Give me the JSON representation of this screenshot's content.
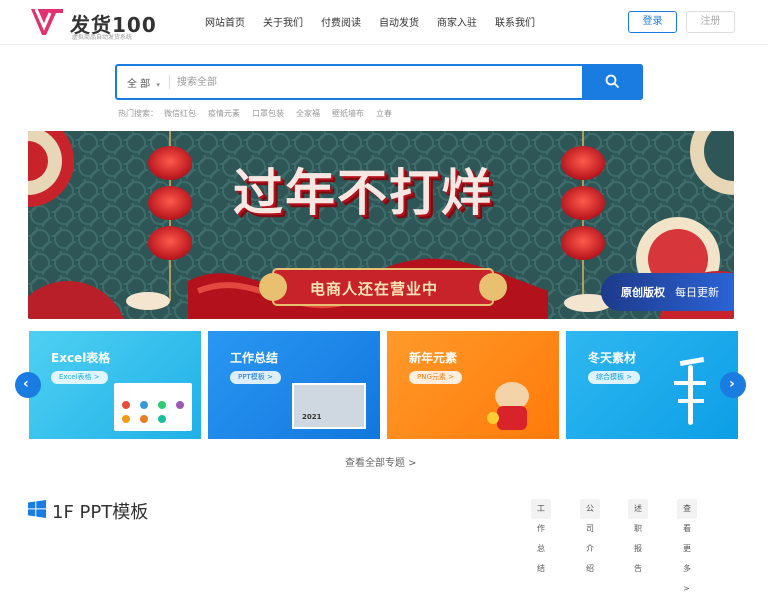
{
  "header": {
    "logo_text": "发货100",
    "logo_sub": "虚拟商品自动发货系统",
    "nav": [
      "网站首页",
      "关于我们",
      "付费阅读",
      "自动发货",
      "商家入驻",
      "联系我们"
    ],
    "login": "登录",
    "register": "注册"
  },
  "search": {
    "category": "全 部",
    "placeholder": "搜索全部",
    "hot_label": "热门搜索：",
    "hot": [
      "微信红包",
      "疫情元素",
      "口罩包装",
      "全家福",
      "壁纸墙布",
      "立春"
    ]
  },
  "banner": {
    "headline": "过年不打烊",
    "sub": "电商人还在营业中",
    "tag_a": "原创版权",
    "tag_b": "每日更新"
  },
  "cards": [
    {
      "title": "Excel表格",
      "pill": "Excel表格 >",
      "color": "#33c2ef"
    },
    {
      "title": "工作总结",
      "pill": "PPT模板 >",
      "color": "#1a8ef2"
    },
    {
      "title": "新年元素",
      "pill": "PNG元素 >",
      "color": "#ff8c1a"
    },
    {
      "title": "冬天素材",
      "pill": "综合模板 >",
      "color": "#1bb5f0"
    }
  ],
  "card_deco": {
    "year": "2021"
  },
  "view_all": "查看全部专题 >",
  "section": {
    "title": "1F PPT模板",
    "tags": [
      "工作总结",
      "公司介绍",
      "述职报告",
      "查看更多 >"
    ]
  }
}
